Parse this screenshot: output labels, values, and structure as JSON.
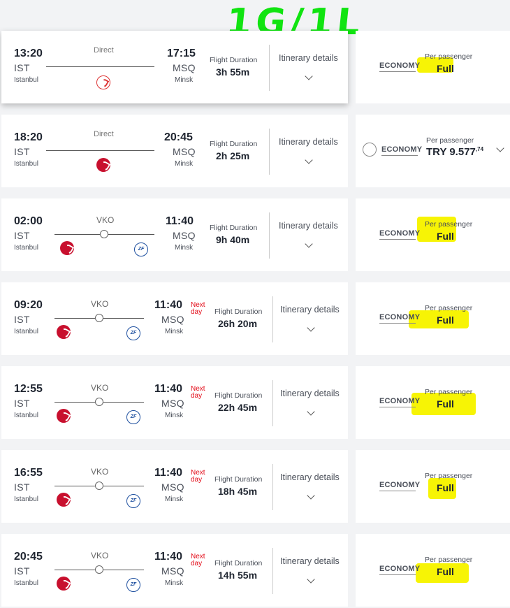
{
  "annotation": "1G/1L",
  "labels": {
    "flight_duration": "Flight Duration",
    "itinerary": "Itinerary details",
    "economy": "ECONOMY",
    "per_passenger": "Per passenger",
    "next_day": "Next\nday"
  },
  "colors": {
    "highlight": "#f7f405",
    "annotation": "#11e411",
    "next_day": "#e30a17"
  },
  "flights": [
    {
      "dep_time": "13:20",
      "dep_code": "IST",
      "dep_city": "Istanbul",
      "arr_time": "17:15",
      "arr_code": "MSQ",
      "arr_city": "Minsk",
      "stop": "Direct",
      "duration": "3h 55m",
      "fare": "Full",
      "next_day": false
    },
    {
      "dep_time": "18:20",
      "dep_code": "IST",
      "dep_city": "Istanbul",
      "arr_time": "20:45",
      "arr_code": "MSQ",
      "arr_city": "Minsk",
      "stop": "Direct",
      "duration": "2h 25m",
      "fare": "TRY 9.577",
      "fare_decimals": ",74",
      "next_day": false
    },
    {
      "dep_time": "02:00",
      "dep_code": "IST",
      "dep_city": "Istanbul",
      "arr_time": "11:40",
      "arr_code": "MSQ",
      "arr_city": "Minsk",
      "stop": "VKO",
      "duration": "9h 40m",
      "fare": "Full",
      "next_day": false
    },
    {
      "dep_time": "09:20",
      "dep_code": "IST",
      "dep_city": "Istanbul",
      "arr_time": "11:40",
      "arr_code": "MSQ",
      "arr_city": "Minsk",
      "stop": "VKO",
      "duration": "26h 20m",
      "fare": "Full",
      "next_day": true
    },
    {
      "dep_time": "12:55",
      "dep_code": "IST",
      "dep_city": "Istanbul",
      "arr_time": "11:40",
      "arr_code": "MSQ",
      "arr_city": "Minsk",
      "stop": "VKO",
      "duration": "22h 45m",
      "fare": "Full",
      "next_day": true
    },
    {
      "dep_time": "16:55",
      "dep_code": "IST",
      "dep_city": "Istanbul",
      "arr_time": "11:40",
      "arr_code": "MSQ",
      "arr_city": "Minsk",
      "stop": "VKO",
      "duration": "18h 45m",
      "fare": "Full",
      "next_day": true
    },
    {
      "dep_time": "20:45",
      "dep_code": "IST",
      "dep_city": "Istanbul",
      "arr_time": "11:40",
      "arr_code": "MSQ",
      "arr_city": "Minsk",
      "stop": "VKO",
      "duration": "14h 55m",
      "fare": "Full",
      "next_day": true
    }
  ]
}
